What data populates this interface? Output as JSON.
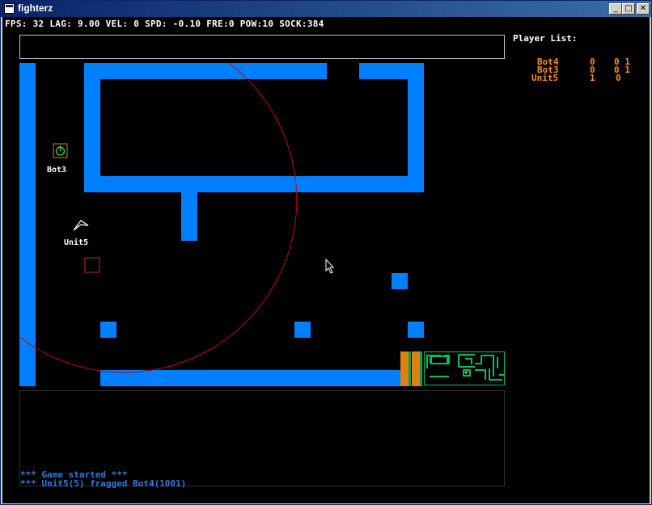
{
  "window": {
    "title": "fighterz",
    "controls": {
      "minimize": "_",
      "maximize": "□",
      "close": "✕"
    }
  },
  "hud": {
    "stats": "FPS: 32 LAG: 9.00 VEL: 0 SPD: -0.10 FRE:0 POW:10 SOCK:384"
  },
  "player_list": {
    "title": "Player List:",
    "players": [
      {
        "name": "Bot4",
        "c1": "0",
        "c2": "0 1"
      },
      {
        "name": "Bot3",
        "c1": "0",
        "c2": "0 1"
      },
      {
        "name": "Unit5",
        "c1": "1",
        "c2": "0"
      }
    ]
  },
  "arena": {
    "units": [
      {
        "name": "Bot3",
        "kind": "bot",
        "icon": "power-icon"
      },
      {
        "name": "Unit5",
        "kind": "player",
        "icon": "ship-icon"
      }
    ],
    "colors": {
      "wall": "#0080ff",
      "player_name": "#ff8c1a",
      "log_text": "#2b7be0",
      "radar": "#cc0000",
      "minimap": "#00c060"
    }
  },
  "log": {
    "lines": [
      "*** Game started ***",
      "*** Unit5(5) fragged Bot4(1001)"
    ]
  }
}
